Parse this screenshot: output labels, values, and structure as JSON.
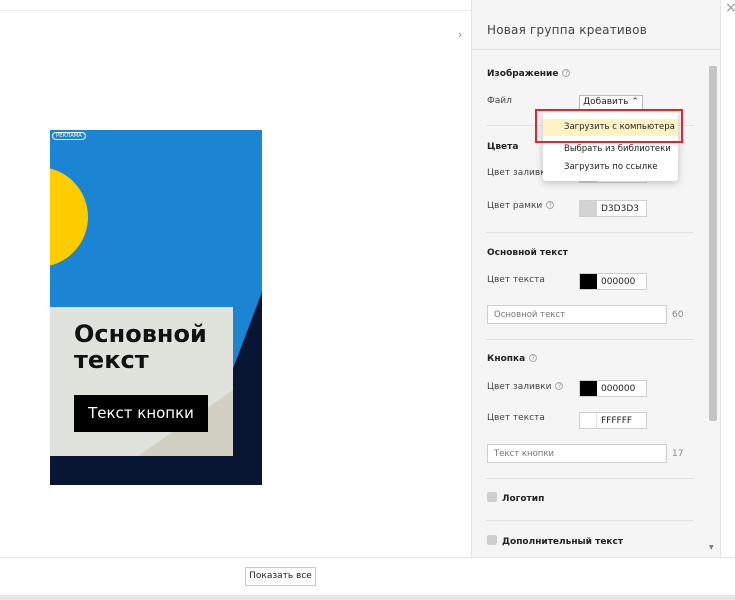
{
  "panel": {
    "title": "Новая группа креативов",
    "image_section": {
      "title": "Изображение",
      "file_label": "Файл",
      "add_button": "Добавить"
    },
    "colors_section": {
      "title": "Цвета",
      "fill_label": "Цвет заливки",
      "border_label": "Цвет рамки",
      "border_value": "D3D3D3"
    },
    "main_text_section": {
      "title": "Основной текст",
      "text_color_label": "Цвет текста",
      "text_color_value": "000000",
      "input_placeholder": "Основной текст",
      "counter": "60"
    },
    "button_section": {
      "title": "Кнопка",
      "fill_label": "Цвет заливки",
      "fill_value": "000000",
      "text_color_label": "Цвет текста",
      "text_color_value": "FFFFFF",
      "input_placeholder": "Текст кнопки",
      "counter": "17"
    },
    "logo_label": "Логотип",
    "extra_text_label": "Дополнительный текст"
  },
  "dropdown": {
    "items": [
      "Загрузить с компьютера",
      "Выбрать из библиотеки",
      "Загрузить по ссылке"
    ],
    "highlighted_index": 0
  },
  "preview": {
    "ad_badge": "РЕКЛАМА",
    "main_text": "Основной текст",
    "button_text": "Текст кнопки"
  },
  "footer": {
    "show_all": "Показать все"
  },
  "colors": {
    "preview_blue": "#1b85d4",
    "preview_yellow": "#ffcc00",
    "preview_navy": "#081634",
    "preview_card": "#dfe3dc",
    "highlight": "#fff3c4",
    "annotation_red": "#e0262c"
  }
}
